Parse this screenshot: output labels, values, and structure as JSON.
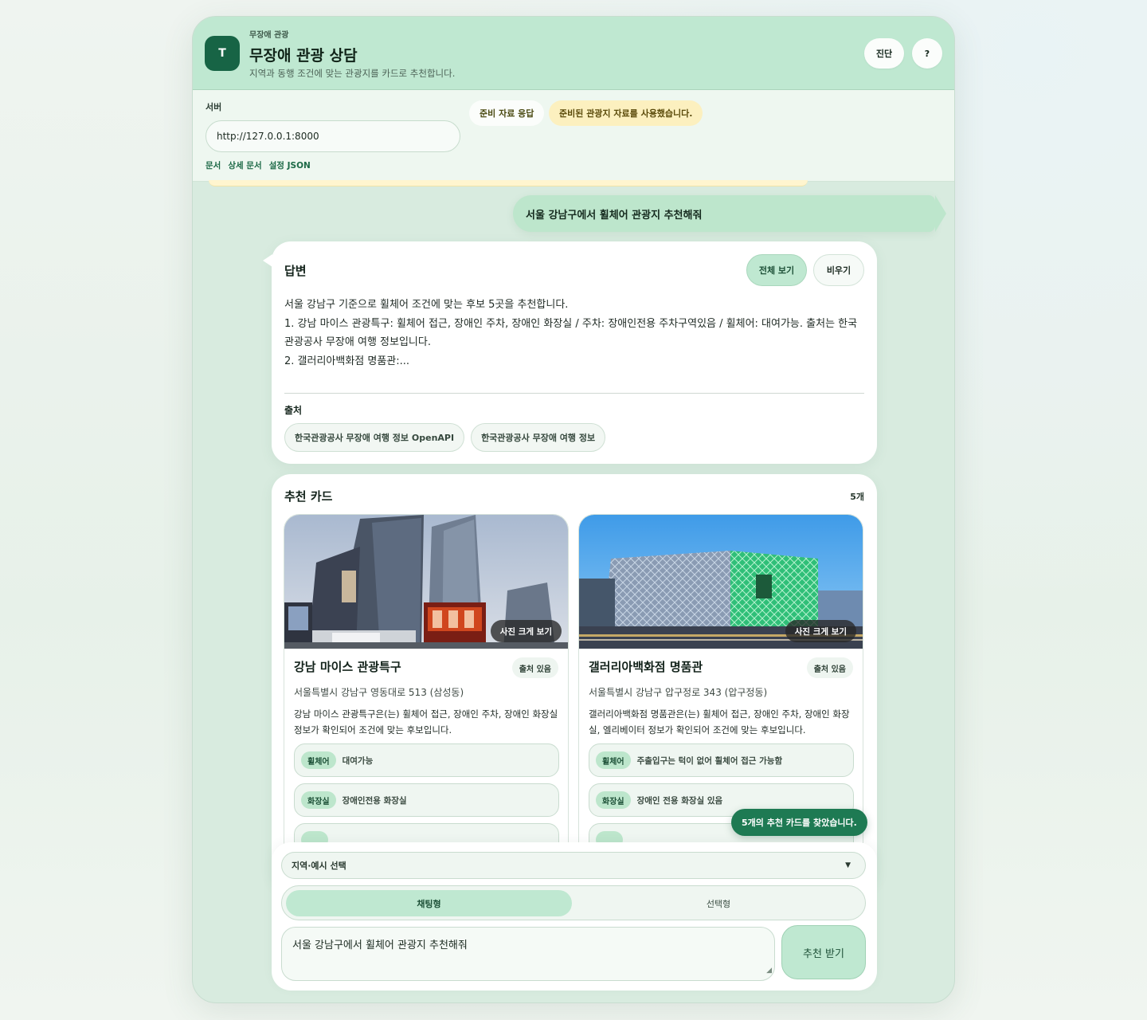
{
  "header": {
    "logo_letter": "T",
    "eyebrow": "무장애 관광",
    "title": "무장애 관광 상담",
    "subtitle": "지역과 동행 조건에 맞는 관광지를 카드로 추천합니다.",
    "diagnose_label": "진단",
    "help_label": "?"
  },
  "server": {
    "label": "서버",
    "url": "http://127.0.0.1:8000",
    "links": [
      "문서",
      "상세 문서",
      "설정 JSON"
    ],
    "status_pill": "준비 자료 응답",
    "notice_pill": "준비된 관광지 자료를 사용했습니다."
  },
  "user_message": "서울 강남구에서 휠체어 관광지 추천해줘",
  "answer": {
    "title": "답변",
    "show_all_label": "전체 보기",
    "clear_label": "비우기",
    "lines": [
      "서울 강남구 기준으로 휠체어 조건에 맞는 후보 5곳을 추천합니다.",
      "1. 강남 마이스 관광특구: 휠체어 접근, 장애인 주차, 장애인 화장실 / 주차: 장애인전용 주차구역있음 / 휠체어: 대여가능. 출처는 한국관광공사 무장애 여행 정보입니다.",
      "2. 갤러리아백화점 명품관:..."
    ],
    "sources_title": "출처",
    "sources": [
      "한국관광공사 무장애 여행 정보 OpenAPI",
      "한국관광공사 무장애 여행 정보"
    ]
  },
  "recommendations": {
    "title": "추천 카드",
    "count": "5개",
    "zoom_label": "사진 크게 보기",
    "cards": [
      {
        "name": "강남 마이스 관광특구",
        "source_badge": "출처 있음",
        "address": "서울특별시 강남구 영동대로 513 (삼성동)",
        "description": "강남 마이스 관광특구은(는) 휠체어 접근, 장애인 주차, 장애인 화장실 정보가 확인되어 조건에 맞는 후보입니다.",
        "features": [
          {
            "tag": "휠체어",
            "value": "대여가능"
          },
          {
            "tag": "화장실",
            "value": "장애인전용 화장실"
          }
        ]
      },
      {
        "name": "갤러리아백화점 명품관",
        "source_badge": "출처 있음",
        "address": "서울특별시 강남구 압구정로 343 (압구정동)",
        "description": "갤러리아백화점 명품관은(는) 휠체어 접근, 장애인 주차, 장애인 화장실, 엘리베이터 정보가 확인되어 조건에 맞는 후보입니다.",
        "features": [
          {
            "tag": "휠체어",
            "value": "주출입구는 턱이 없어 휠체어 접근 가능함"
          },
          {
            "tag": "화장실",
            "value": "장애인 전용 화장실 있음"
          }
        ]
      }
    ]
  },
  "toast": "5개의 추천 카드를 찾았습니다.",
  "composer": {
    "region_select": "지역·예시 선택",
    "mode_chat": "채팅형",
    "mode_pick": "선택형",
    "input_value": "서울 강남구에서 휠체어 관광지 추천해줘",
    "submit_label": "추천 받기"
  },
  "colors": {
    "accent": "#176445",
    "header_bg": "#bfe8d1",
    "notice_bg": "#fcf0bf",
    "toast_bg": "#1e7a53"
  },
  "icons": [
    "chevron-down-icon",
    "resize-grip-icon"
  ]
}
